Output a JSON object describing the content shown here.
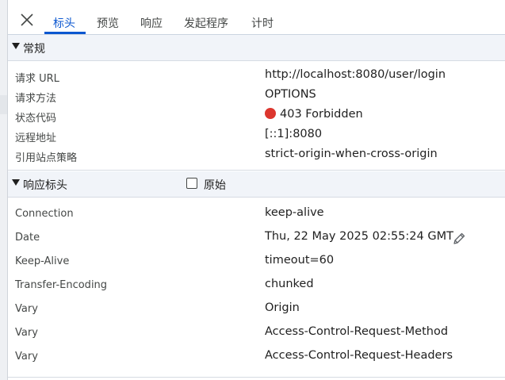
{
  "tabs": [
    {
      "label": "标头",
      "active": true
    },
    {
      "label": "预览",
      "active": false
    },
    {
      "label": "响应",
      "active": false
    },
    {
      "label": "发起程序",
      "active": false
    },
    {
      "label": "计时",
      "active": false
    }
  ],
  "general": {
    "title": "常规",
    "rows": [
      {
        "key": "请求 URL",
        "value": "http://localhost:8080/user/login"
      },
      {
        "key": "请求方法",
        "value": "OPTIONS"
      },
      {
        "key": "状态代码",
        "value": "403 Forbidden"
      },
      {
        "key": "远程地址",
        "value": "[::1]:8080"
      },
      {
        "key": "引用站点策略",
        "value": "strict-origin-when-cross-origin"
      }
    ]
  },
  "response_headers": {
    "title": "响应标头",
    "raw_label": "原始",
    "raw_checked": false,
    "rows": [
      {
        "key": "Connection",
        "value": "keep-alive"
      },
      {
        "key": "Date",
        "value": "Thu, 22 May 2025 02:55:24 GMT"
      },
      {
        "key": "Keep-Alive",
        "value": "timeout=60"
      },
      {
        "key": "Transfer-Encoding",
        "value": "chunked"
      },
      {
        "key": "Vary",
        "value": "Origin"
      },
      {
        "key": "Vary",
        "value": "Access-Control-Request-Method"
      },
      {
        "key": "Vary",
        "value": "Access-Control-Request-Headers"
      }
    ]
  },
  "colors": {
    "accent": "#0b57d0",
    "status_error": "#dc362e",
    "section_bg": "#f1f4f9"
  },
  "icons": {
    "close": "close-icon",
    "expand": "triangle-down-icon",
    "edit": "pencil-icon",
    "status": "status-dot-icon"
  }
}
